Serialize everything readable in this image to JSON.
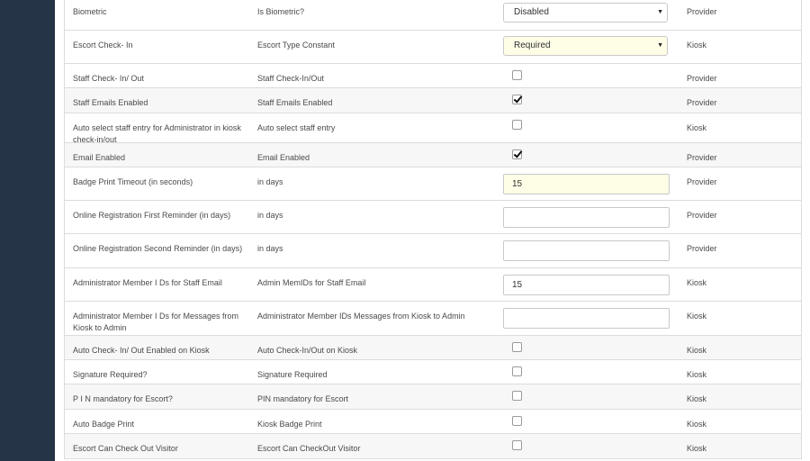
{
  "rows": [
    {
      "label": "Biometric",
      "setting": "Is Biometric?",
      "control": "select",
      "value": "Disabled",
      "highlight": false,
      "scope": "Provider",
      "alt": false,
      "height": 37
    },
    {
      "label": "Escort Check- In",
      "setting": "Escort Type Constant",
      "control": "select",
      "value": "Required",
      "highlight": true,
      "scope": "Kiosk",
      "alt": false,
      "height": 37
    },
    {
      "label": "Staff Check- In/ Out",
      "setting": "Staff Check-In/Out",
      "control": "checkbox",
      "checked": false,
      "scope": "Provider",
      "alt": false,
      "height": 27
    },
    {
      "label": "Staff Emails Enabled",
      "setting": "Staff Emails Enabled",
      "control": "checkbox",
      "checked": true,
      "scope": "Provider",
      "alt": true,
      "height": 28
    },
    {
      "label": "Auto select staff entry for Administrator in kiosk check-in/out",
      "setting": "Auto select staff entry",
      "control": "checkbox",
      "checked": false,
      "scope": "Kiosk",
      "alt": false,
      "height": 33
    },
    {
      "label": "Email Enabled",
      "setting": "Email Enabled",
      "control": "checkbox",
      "checked": true,
      "scope": "Provider",
      "alt": true,
      "height": 27
    },
    {
      "label": "Badge Print Timeout (in seconds)",
      "setting": "in days",
      "control": "input",
      "value": "15",
      "highlight": true,
      "scope": "Provider",
      "alt": false,
      "height": 37
    },
    {
      "label": "Online Registration First Reminder (in days)",
      "setting": "in days",
      "control": "input",
      "value": "",
      "highlight": false,
      "scope": "Provider",
      "alt": false,
      "height": 37
    },
    {
      "label": "Online Registration Second Reminder (in days)",
      "setting": "in days",
      "control": "input",
      "value": "",
      "highlight": false,
      "scope": "Provider",
      "alt": false,
      "height": 38
    },
    {
      "label": "Administrator Member I Ds for Staff Email",
      "setting": "Admin MemIDs for Staff Email",
      "control": "input",
      "value": "15",
      "highlight": false,
      "scope": "Kiosk",
      "alt": false,
      "height": 37
    },
    {
      "label": "Administrator Member I Ds for Messages from Kiosk to Admin",
      "setting": "Administrator Member IDs Messages from Kiosk to Admin",
      "control": "input",
      "value": "",
      "highlight": false,
      "scope": "Kiosk",
      "alt": false,
      "height": 38
    },
    {
      "label": "Auto Check- In/ Out Enabled on Kiosk",
      "setting": "Auto Check-In/Out on Kiosk",
      "control": "checkbox",
      "checked": false,
      "scope": "Kiosk",
      "alt": true,
      "height": 27
    },
    {
      "label": "Signature Required?",
      "setting": "Signature Required",
      "control": "checkbox",
      "checked": false,
      "scope": "Kiosk",
      "alt": false,
      "height": 27
    },
    {
      "label": "P I N mandatory for Escort?",
      "setting": "PIN mandatory for Escort",
      "control": "checkbox",
      "checked": false,
      "scope": "Kiosk",
      "alt": true,
      "height": 28
    },
    {
      "label": "Auto Badge Print",
      "setting": "Kiosk Badge Print",
      "control": "checkbox",
      "checked": false,
      "scope": "Kiosk",
      "alt": false,
      "height": 27
    },
    {
      "label": "Escort Can Check Out Visitor",
      "setting": "Escort Can CheckOut Visitor",
      "control": "checkbox",
      "checked": false,
      "scope": "Kiosk",
      "alt": true,
      "height": 28
    }
  ]
}
